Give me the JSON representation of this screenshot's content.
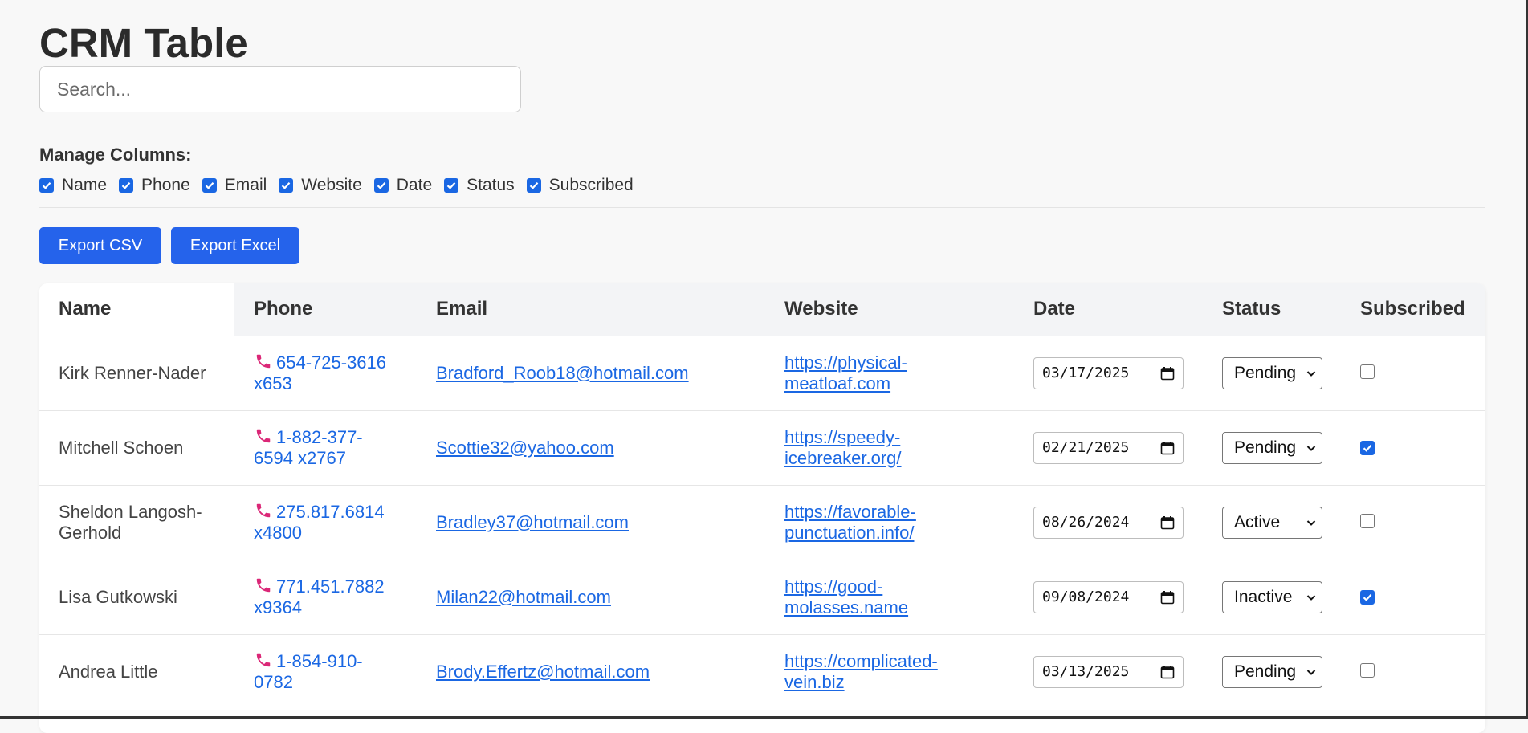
{
  "page": {
    "title": "CRM Table"
  },
  "search": {
    "placeholder": "Search..."
  },
  "columns_manager": {
    "label": "Manage Columns:",
    "toggles": [
      {
        "label": "Name",
        "checked": true
      },
      {
        "label": "Phone",
        "checked": true
      },
      {
        "label": "Email",
        "checked": true
      },
      {
        "label": "Website",
        "checked": true
      },
      {
        "label": "Date",
        "checked": true
      },
      {
        "label": "Status",
        "checked": true
      },
      {
        "label": "Subscribed",
        "checked": true
      }
    ]
  },
  "toolbar": {
    "export_csv": "Export CSV",
    "export_excel": "Export Excel"
  },
  "table": {
    "headers": [
      "Name",
      "Phone",
      "Email",
      "Website",
      "Date",
      "Status",
      "Subscribed"
    ],
    "rows": [
      {
        "name": "Kirk Renner-Nader",
        "phone_1": "654-725-3616",
        "phone_2": "x653",
        "email": "Bradford_Roob18@hotmail.com",
        "website_1": "https://physical-",
        "website_2": "meatloaf.com",
        "date": "03/17/2025",
        "status": "Pending",
        "subscribed": false
      },
      {
        "name": "Mitchell Schoen",
        "phone_1": "1-882-377-",
        "phone_2": "6594 x2767",
        "email": "Scottie32@yahoo.com",
        "website_1": "https://speedy-",
        "website_2": "icebreaker.org/",
        "date": "02/21/2025",
        "status": "Pending",
        "subscribed": true
      },
      {
        "name_1": "Sheldon Langosh-",
        "name_2": "Gerhold",
        "phone_1": "275.817.6814",
        "phone_2": "x4800",
        "email": "Bradley37@hotmail.com",
        "website_1": "https://favorable-",
        "website_2": "punctuation.info/",
        "date": "08/26/2024",
        "status": "Active",
        "subscribed": false
      },
      {
        "name": "Lisa Gutkowski",
        "phone_1": "771.451.7882",
        "phone_2": "x9364",
        "email": "Milan22@hotmail.com",
        "website_1": "https://good-",
        "website_2": "molasses.name",
        "date": "09/08/2024",
        "status": "Inactive",
        "subscribed": true
      },
      {
        "name": "Andrea Little",
        "phone_1": "1-854-910-",
        "phone_2": "0782",
        "email": "Brody.Effertz@hotmail.com",
        "website_1": "https://complicated-",
        "website_2": "vein.biz",
        "date": "03/13/2025",
        "status": "Pending",
        "subscribed": false
      }
    ]
  },
  "icons": {
    "phone": "phone-icon",
    "calendar": "calendar-icon",
    "select": "chevron-down-icon",
    "check": "check-icon"
  },
  "colors": {
    "accent": "#2563eb",
    "link": "#1a67e3",
    "phone_icon": "#db2777",
    "header_bg": "#f3f4f6"
  }
}
